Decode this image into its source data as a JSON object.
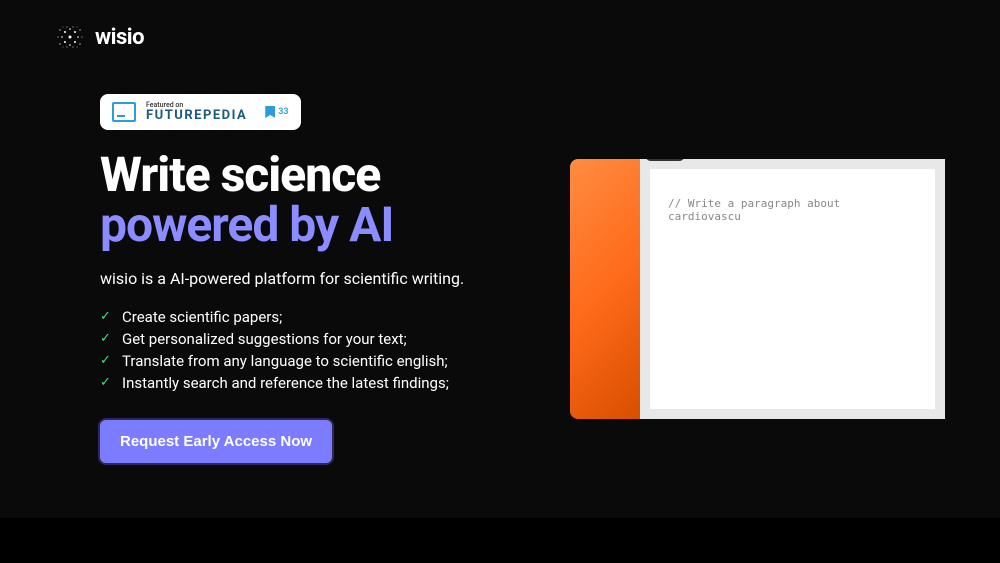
{
  "header": {
    "brand": "wisio"
  },
  "badge": {
    "featured": "Featured on",
    "name": "FUTUREPEDIA",
    "count": "33"
  },
  "headline": {
    "line1": "Write science",
    "line2": "powered by AI"
  },
  "subtitle": "wisio is a AI-powered platform for scientific writing.",
  "features": [
    "Create scientific papers;",
    "Get personalized suggestions for your text;",
    "Translate from any language to scientific english;",
    "Instantly search and reference the latest findings;"
  ],
  "cta": {
    "label": "Request Early Access Now"
  },
  "demo": {
    "text": "// Write a paragraph about cardiovascu"
  }
}
